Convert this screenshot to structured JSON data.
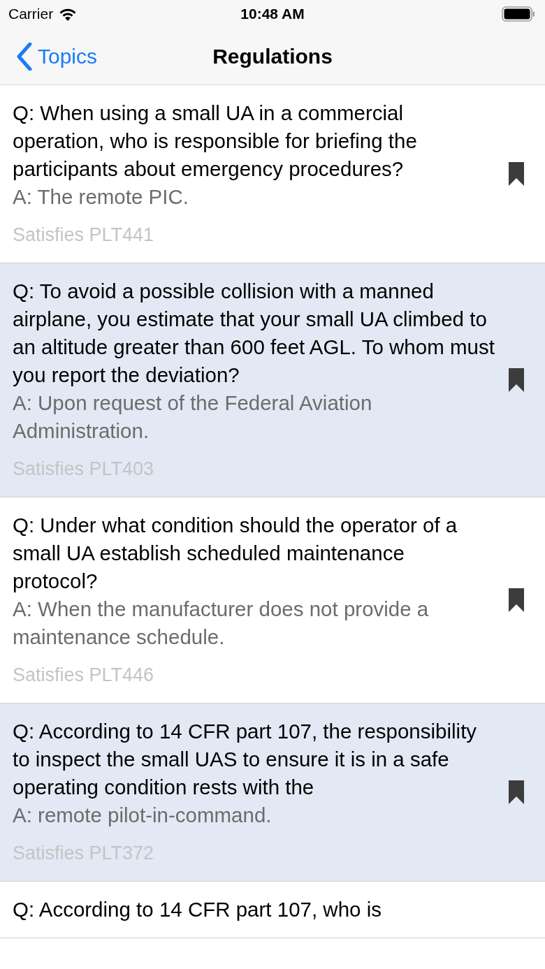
{
  "status_bar": {
    "carrier": "Carrier",
    "time": "10:48 AM"
  },
  "nav_bar": {
    "back": "Topics",
    "title": "Regulations"
  },
  "questions": [
    {
      "question": "Q: When using a small UA in a commercial operation, who is responsible for briefing the participants about emergency procedures?",
      "answer": "A: The remote PIC.",
      "reference": "Satisfies PLT441"
    },
    {
      "question": "Q: To avoid a possible collision with a manned airplane, you estimate that your small UA climbed to an altitude greater than 600 feet AGL. To whom must you report the deviation?",
      "answer": "A: Upon request of the Federal Aviation Administration.",
      "reference": "Satisfies PLT403"
    },
    {
      "question": "Q: Under what condition should the operator of a small UA establish scheduled maintenance protocol?",
      "answer": "A: When the manufacturer does not provide a maintenance schedule.",
      "reference": "Satisfies PLT446"
    },
    {
      "question": "Q: According to 14 CFR part 107, the responsibility to inspect the small UAS to ensure it is in a safe operating condition rests with the",
      "answer": "A: remote pilot-in-command.",
      "reference": "Satisfies PLT372"
    },
    {
      "question": "Q: According to 14 CFR part 107, who is"
    }
  ]
}
